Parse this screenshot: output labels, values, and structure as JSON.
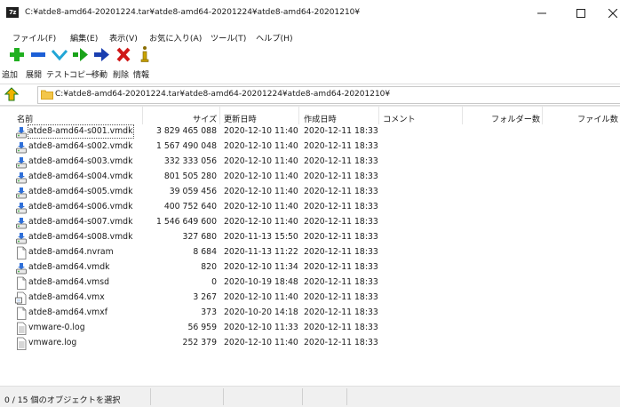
{
  "window": {
    "app_icon_text": "7z",
    "title": "C:¥atde8-amd64-20201224.tar¥atde8-amd64-20201224¥atde8-amd64-20201210¥"
  },
  "menu": {
    "file": "ファイル(F)",
    "edit": "編集(E)",
    "view": "表示(V)",
    "favorites": "お気に入り(A)",
    "tools": "ツール(T)",
    "help": "ヘルプ(H)"
  },
  "toolbar": {
    "add": "追加",
    "extract": "展開",
    "test": "テスト",
    "copy": "コピー",
    "move": "移動",
    "delete": "削除",
    "info": "情報"
  },
  "address": {
    "path": "C:¥atde8-amd64-20201224.tar¥atde8-amd64-20201224¥atde8-amd64-20201210¥"
  },
  "columns": {
    "name": "名前",
    "size": "サイズ",
    "modified": "更新日時",
    "created": "作成日時",
    "comment": "コメント",
    "folders": "フォルダー数",
    "files": "ファイル数"
  },
  "files": [
    {
      "name": "atde8-amd64-s001.vmdk",
      "size": "3 829 465 088",
      "modified": "2020-12-10 11:40",
      "created": "2020-12-11 18:33",
      "icon": "vmdk-disk-icon"
    },
    {
      "name": "atde8-amd64-s002.vmdk",
      "size": "1 567 490 048",
      "modified": "2020-12-10 11:40",
      "created": "2020-12-11 18:33",
      "icon": "vmdk-disk-icon"
    },
    {
      "name": "atde8-amd64-s003.vmdk",
      "size": "332 333 056",
      "modified": "2020-12-10 11:40",
      "created": "2020-12-11 18:33",
      "icon": "vmdk-disk-icon"
    },
    {
      "name": "atde8-amd64-s004.vmdk",
      "size": "801 505 280",
      "modified": "2020-12-10 11:40",
      "created": "2020-12-11 18:33",
      "icon": "vmdk-disk-icon"
    },
    {
      "name": "atde8-amd64-s005.vmdk",
      "size": "39 059 456",
      "modified": "2020-12-10 11:40",
      "created": "2020-12-11 18:33",
      "icon": "vmdk-disk-icon"
    },
    {
      "name": "atde8-amd64-s006.vmdk",
      "size": "400 752 640",
      "modified": "2020-12-10 11:40",
      "created": "2020-12-11 18:33",
      "icon": "vmdk-disk-icon"
    },
    {
      "name": "atde8-amd64-s007.vmdk",
      "size": "1 546 649 600",
      "modified": "2020-12-10 11:40",
      "created": "2020-12-11 18:33",
      "icon": "vmdk-disk-icon"
    },
    {
      "name": "atde8-amd64-s008.vmdk",
      "size": "327 680",
      "modified": "2020-11-13 15:50",
      "created": "2020-12-11 18:33",
      "icon": "vmdk-disk-icon"
    },
    {
      "name": "atde8-amd64.nvram",
      "size": "8 684",
      "modified": "2020-11-13 11:22",
      "created": "2020-12-11 18:33",
      "icon": "blank-file-icon"
    },
    {
      "name": "atde8-amd64.vmdk",
      "size": "820",
      "modified": "2020-12-10 11:34",
      "created": "2020-12-11 18:33",
      "icon": "vmdk-disk-icon"
    },
    {
      "name": "atde8-amd64.vmsd",
      "size": "0",
      "modified": "2020-10-19 18:48",
      "created": "2020-12-11 18:33",
      "icon": "blank-file-icon"
    },
    {
      "name": "atde8-amd64.vmx",
      "size": "3 267",
      "modified": "2020-12-10 11:40",
      "created": "2020-12-11 18:33",
      "icon": "vmx-config-icon"
    },
    {
      "name": "atde8-amd64.vmxf",
      "size": "373",
      "modified": "2020-10-20 14:18",
      "created": "2020-12-11 18:33",
      "icon": "blank-file-icon"
    },
    {
      "name": "vmware-0.log",
      "size": "56 959",
      "modified": "2020-12-10 11:33",
      "created": "2020-12-11 18:33",
      "icon": "text-file-icon"
    },
    {
      "name": "vmware.log",
      "size": "252 379",
      "modified": "2020-12-10 11:40",
      "created": "2020-12-11 18:33",
      "icon": "text-file-icon"
    }
  ],
  "status": {
    "selection": "0 / 15 個のオブジェクトを選択"
  },
  "colors": {
    "add_green": "#20b020",
    "extract_blue": "#1c5fd6",
    "test_cyan": "#22a6d6",
    "copy_green": "#1aa31a",
    "move_navy": "#1a3fb0",
    "delete_red": "#d01818",
    "folder_yellow": "#f3c64a"
  }
}
